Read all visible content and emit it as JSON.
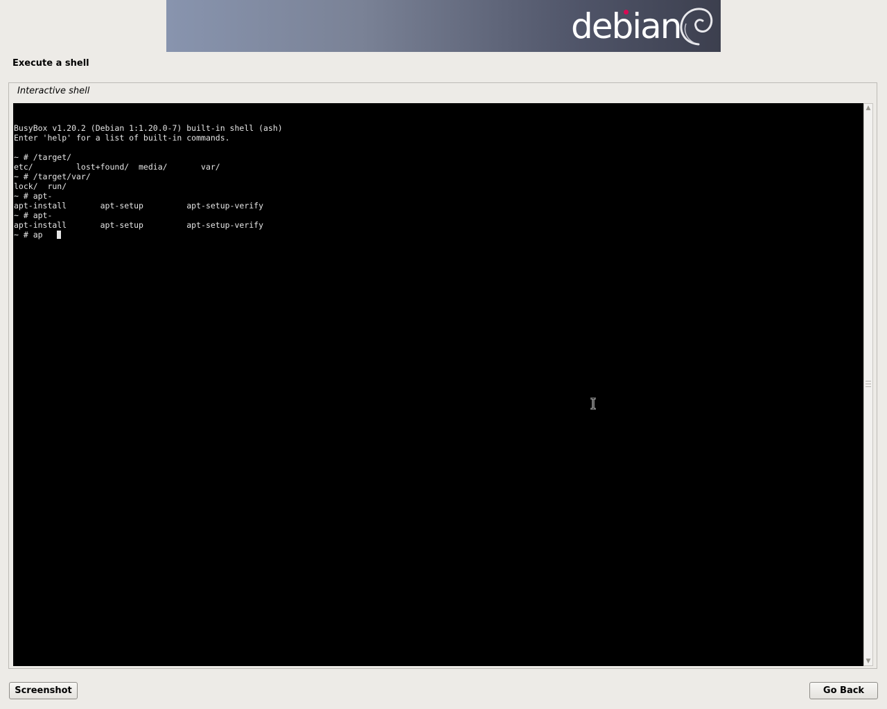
{
  "banner": {
    "logo_text": "debian",
    "logo_icon": "debian-swirl-icon",
    "accent_color": "#d70a53"
  },
  "page": {
    "title": "Execute a shell"
  },
  "shell": {
    "frame_label": "Interactive shell",
    "lines": [
      "",
      "BusyBox v1.20.2 (Debian 1:1.20.0-7) built-in shell (ash)",
      "Enter 'help' for a list of built-in commands.",
      "",
      "~ # /target/",
      "etc/         lost+found/  media/       var/",
      "~ # /target/var/",
      "lock/  run/",
      "~ # apt-",
      "apt-install       apt-setup         apt-setup-verify",
      "~ # apt-",
      "apt-install       apt-setup         apt-setup-verify",
      "~ # ap"
    ]
  },
  "buttons": {
    "screenshot": "Screenshot",
    "go_back": "Go Back"
  }
}
